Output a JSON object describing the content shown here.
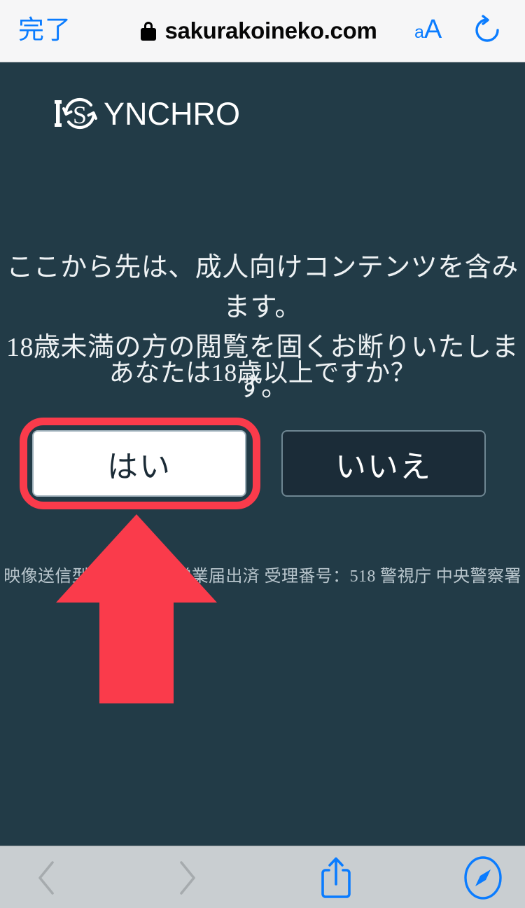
{
  "browser": {
    "done_label": "完了",
    "url": "sakurakoineko.com",
    "lock_icon": "lock-icon",
    "text_size_small": "a",
    "text_size_large": "A",
    "reload_icon": "reload-icon",
    "toolbar": {
      "back_icon": "chevron-left-icon",
      "forward_icon": "chevron-right-icon",
      "share_icon": "share-icon",
      "tabs_icon": "compass-icon"
    },
    "colors": {
      "header_bg": "#f6f6f7",
      "toolbar_bg": "#c9ced1",
      "accent_blue": "#0a7cff",
      "disabled_grey": "#a6abae"
    }
  },
  "page": {
    "logo_text": "ISYNCHRO",
    "logo_icon": "sync-circle-icon",
    "background_color": "#223b47",
    "notice_line_1": "ここから先は、成人向けコンテンツを含みます。",
    "notice_line_2": "18歳未満の方の閲覧を固くお断りいたします。",
    "question": "あなたは18歳以上ですか？",
    "yes_label": "はい",
    "no_label": "いいえ",
    "legal_text": "映像送信型性風俗特殊営業届出済 受理番号：518 警視庁 中央警察署",
    "highlight_color": "#fa3b4b",
    "arrow_icon": "up-arrow-annotation"
  }
}
